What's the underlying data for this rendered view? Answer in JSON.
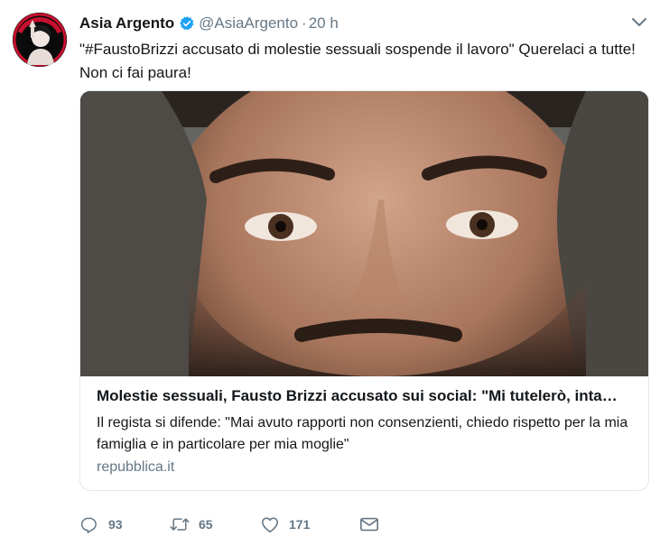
{
  "tweet": {
    "display_name": "Asia Argento",
    "handle": "@AsiaArgento",
    "separator": "·",
    "time": "20 h",
    "text_line1": "\"#FaustoBrizzi accusato di molestie sessuali sospende il lavoro\" Querelaci a tutte!",
    "text_line2": "Non ci fai paura!"
  },
  "card": {
    "title": "Molestie sessuali, Fausto Brizzi accusato sui social: \"Mi tutelerò, inta…",
    "description": "Il regista si difende: \"Mai avuto rapporti non consenzienti, chiedo rispetto per la mia famiglia e in particolare per mia moglie\"",
    "domain": "repubblica.it"
  },
  "actions": {
    "replies": "93",
    "retweets": "65",
    "likes": "171"
  },
  "colors": {
    "text": "#14171a",
    "secondary": "#657786",
    "verified": "#1da1f2",
    "border": "#e1e8ed",
    "avatar_accent": "#e0245e"
  },
  "icons": [
    "verified-badge-icon",
    "chevron-down-icon",
    "reply-icon",
    "retweet-icon",
    "like-icon",
    "direct-message-icon"
  ]
}
